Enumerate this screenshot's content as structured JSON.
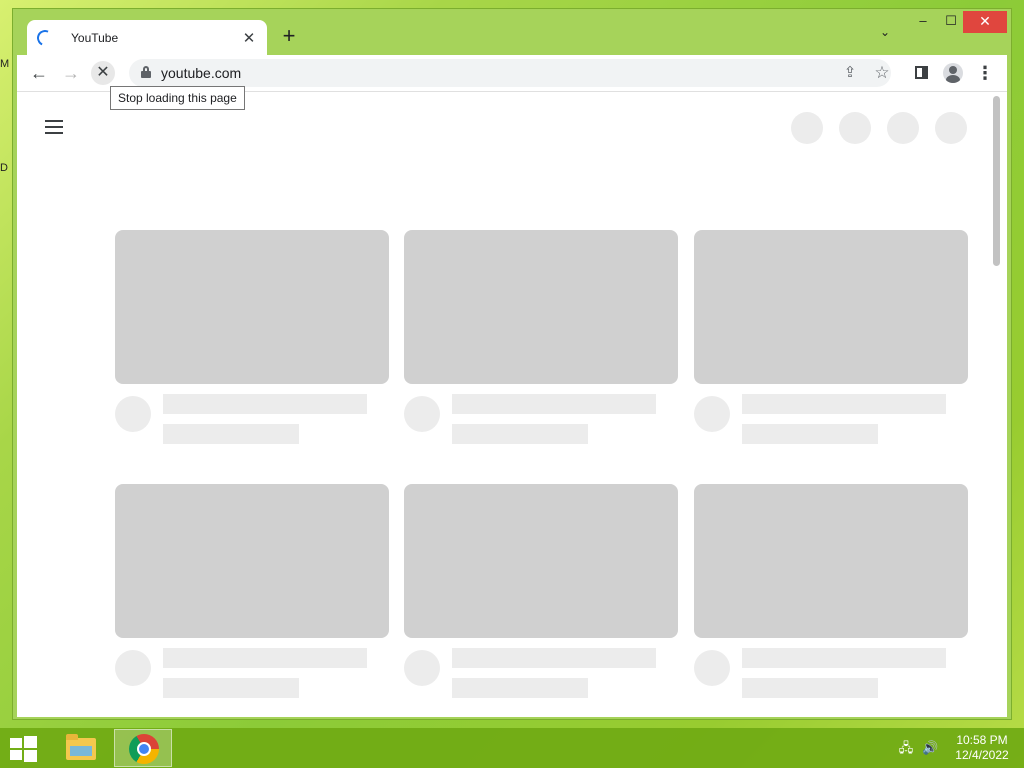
{
  "browser": {
    "tab": {
      "title": "YouTube",
      "close_glyph": "✕"
    },
    "new_tab_glyph": "+",
    "tab_search_glyph": "⌄",
    "window_controls": {
      "minimize": "–",
      "maximize": "☐",
      "close": "✕"
    },
    "toolbar": {
      "back_glyph": "←",
      "forward_glyph": "→",
      "stop_glyph": "✕",
      "url": "youtube.com",
      "share_glyph": "⇪",
      "star_glyph": "☆",
      "menu_glyph": "⋮"
    },
    "tooltip": "Stop loading this page"
  },
  "page": {
    "loading_skeleton": true,
    "header_placeholder_circles": 4,
    "cards": 6
  },
  "taskbar": {
    "apps": [
      "File Explorer",
      "Google Chrome"
    ],
    "active_app": "Google Chrome",
    "tray": {
      "network_icon": "network-icon",
      "volume_icon": "volume-icon"
    },
    "clock": {
      "time": "10:58 PM",
      "date": "12/4/2022"
    }
  },
  "colors": {
    "desktop_accent": "#8ccb38",
    "window_frame": "#a6d35a",
    "skeleton_thumb": "#d0d0d0",
    "skeleton_line": "#ececec",
    "close_button": "#e0463e",
    "loading_spinner": "#1a73e8"
  }
}
